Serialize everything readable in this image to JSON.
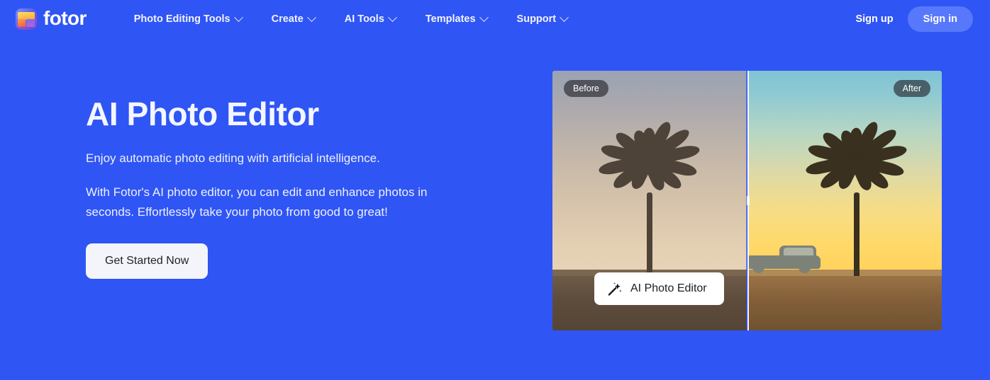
{
  "brand": {
    "name": "fotor",
    "logo_icon": "fotor-logo-icon"
  },
  "header": {
    "nav": [
      {
        "label": "Photo Editing Tools",
        "caret_icon": "chevron-down-icon"
      },
      {
        "label": "Create",
        "caret_icon": "chevron-down-icon"
      },
      {
        "label": "AI Tools",
        "caret_icon": "chevron-down-icon"
      },
      {
        "label": "Templates",
        "caret_icon": "chevron-down-icon"
      },
      {
        "label": "Support",
        "caret_icon": "chevron-down-icon"
      }
    ],
    "sign_up": "Sign up",
    "sign_in": "Sign in"
  },
  "hero": {
    "title": "AI Photo Editor",
    "lead": "Enjoy automatic photo editing with artificial intelligence.",
    "body": "With Fotor's AI photo editor, you can edit and enhance photos in seconds. Effortlessly take your photo from good to great!",
    "cta": "Get Started Now"
  },
  "compare": {
    "before_badge": "Before",
    "after_badge": "After",
    "tool_label": "AI Photo Editor",
    "tool_icon": "magic-wand-icon",
    "divider_handle_icon": "slider-handle-icon"
  },
  "colors": {
    "page_background": "#2f55f5",
    "signin_pill": "#5878fb",
    "cta_background": "#f4f5fb",
    "cta_text": "#1d2026",
    "badge_background": "rgba(32,33,38,0.62)",
    "heading_text": "#f4f6ff"
  }
}
